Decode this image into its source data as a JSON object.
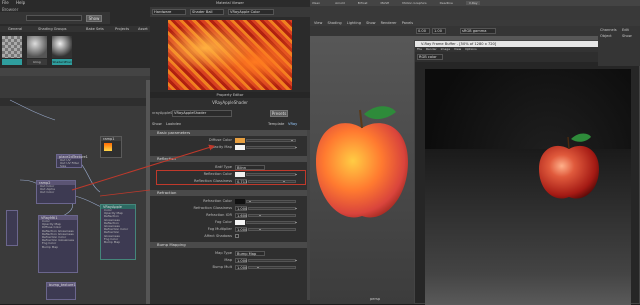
{
  "left_panel": {
    "title": "Browser",
    "menu": [
      "File",
      "Help"
    ],
    "show_button": "Show",
    "tabs": [
      "General",
      "Shading Groups",
      "Bake Sets",
      "Projects",
      "Asset"
    ],
    "swatch_labels": [
      "",
      "",
      "bling",
      "Shader1Envi"
    ]
  },
  "nodes": {
    "place2d": {
      "title": "place2dTexture1",
      "rows": [
        "Out UV",
        "Out UV Filter Size"
      ]
    },
    "ramp": {
      "title": "ramp1",
      "rows": [
        "Out Color",
        "Out Alpha"
      ]
    },
    "ramp2": {
      "title": "ramp2",
      "rows": [
        "Out Color",
        "Out Alpha",
        "Out Color",
        "Out Alpha"
      ]
    },
    "vray_left": {
      "title": "VRayMtl1",
      "rows": [
        "Color",
        "Opacity Map",
        "Diffuse Color",
        "Reflection Glossiness",
        "Reflection Glossiness",
        "Refraction Color",
        "Refraction Glossiness",
        "Fog Color",
        "Bump Map"
      ]
    },
    "vray_right": {
      "title": "VRayApple",
      "rows": [
        "Color",
        "Opacity Map",
        "Reflection Glossiness",
        "Reflection Glossiness",
        "Refraction Color",
        "Refraction Glossiness",
        "Fog Color",
        "Bump Map"
      ]
    },
    "bump": {
      "title": "bump_texture1",
      "rows": []
    },
    "small": {
      "title": "",
      "rows": []
    }
  },
  "material_viewer": {
    "title": "Material Viewer",
    "dropdowns": [
      "Hardware",
      "Shader Ball",
      "VRayApple Color"
    ]
  },
  "property_editor": {
    "title": "Property Editor",
    "shader_type": "VRayAppleShader",
    "node_name": "VRayAppleShader",
    "presets": "Presets",
    "show_label": "Show",
    "hide_label": "Hide",
    "view_label": "View",
    "lookdev_label": "Lookdev",
    "template_label": "Template",
    "template_value": "VRay",
    "sections": {
      "basic": "Basic parameters",
      "reflection": "Reflection",
      "refraction": "Refraction",
      "bump": "Bump Mapping"
    },
    "basic": {
      "diffuse_color": "Diffuse Color",
      "opacity_map": "Opacity Map"
    },
    "reflection": {
      "brdf_type": "Brdf Type",
      "brdf_value": "Blinn",
      "reflection_color": "Reflection Color",
      "reflection_glossiness": "Reflection Glossiness",
      "reflection_glossiness_value": "0.713"
    },
    "refraction": {
      "refraction_color": "Refraction Color",
      "refraction_glossiness": "Refraction Glossiness",
      "refraction_glossiness_value": "1.000",
      "refraction_ior": "Refraction IOR",
      "refraction_ior_value": "1.600",
      "fog_color": "Fog Color",
      "fog_multiplier": "Fog Multiplier",
      "fog_multiplier_value": "1.000",
      "affect_shadows": "Affect Shadows"
    },
    "bump_mapping": {
      "map_type": "Map Type",
      "map_type_value": "Bump Map",
      "map": "Map",
      "map_value": "1.000",
      "bump_mult": "Bump Mult",
      "bump_mult_value": "1.000"
    }
  },
  "viewport": {
    "menu": [
      "View",
      "Shading",
      "Lighting",
      "Show",
      "Renderer",
      "Panels"
    ],
    "camera_field": "0.00",
    "camera_field2": "1.00",
    "color_space": "sRGB gamma",
    "camera_label": "persp",
    "tabs": [
      "Curves / Surfaces",
      "Poly Modeling",
      "Sculpting",
      "Rigging",
      "Animation",
      "Rendering",
      "FX",
      "FX Caching",
      "Custom",
      "XGen",
      "Arnold",
      "Bifrost",
      "MASH",
      "Motion Graphics",
      "Deadline",
      "V-Ray"
    ]
  },
  "vfb": {
    "title": "V-Ray Frame Buffer - [50% of 1280 x 720]",
    "channel": "RGB color",
    "menu": [
      "File",
      "Render",
      "Image",
      "View",
      "Options"
    ]
  },
  "right_panel": {
    "items": [
      "Channels",
      "Edit",
      "Object",
      "Show"
    ]
  },
  "colors": {
    "accent_red": "#c0392b",
    "node_purple": "#5b5474",
    "node_teal": "#2c6b63",
    "diffuse_swatch": "#e8a040",
    "apple_red": "#d9443c",
    "leaf_green": "#2e8b3a"
  }
}
